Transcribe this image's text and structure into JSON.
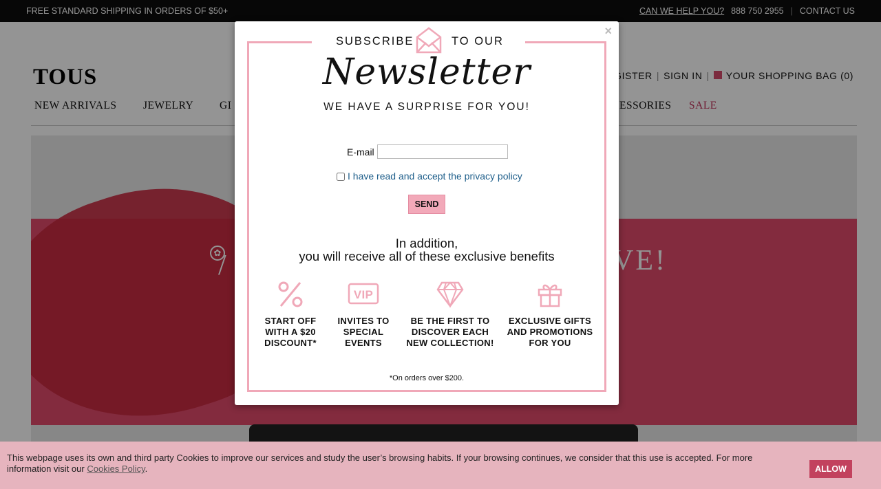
{
  "topbar": {
    "shipping": "FREE STANDARD SHIPPING IN ORDERS OF $50+",
    "help": "CAN WE HELP YOU?",
    "phone": "888 750 2955",
    "separator": "|",
    "contact": "CONTACT US"
  },
  "header": {
    "logo": "TOUS",
    "register": "REGISTER",
    "signin": "SIGN IN",
    "separator": "|",
    "bag": "YOUR SHOPPING BAG (0)"
  },
  "nav": {
    "items": [
      "NEW ARRIVALS",
      "JEWELRY",
      "GI",
      "ESSORIES",
      "SALE"
    ]
  },
  "hero": {
    "partial_left": "/",
    "partial_right": "VE!"
  },
  "modal": {
    "close": "×",
    "subscribe_left": "SUBSCRIBE",
    "subscribe_right": "TO OUR",
    "newsletter": "Newsletter",
    "surprise": "WE HAVE A SURPRISE FOR YOU!",
    "email_label": "E-mail",
    "email_value": "",
    "privacy": "I have read and accept the privacy policy",
    "send": "SEND",
    "addition_line1": "In addition,",
    "addition_line2": "you will receive all of these exclusive benefits",
    "benefits": [
      {
        "icon": "percent-icon",
        "lines": [
          "START OFF",
          "WITH A $20",
          "DISCOUNT*"
        ]
      },
      {
        "icon": "vip-icon",
        "lines": [
          "INVITES TO",
          "SPECIAL",
          "EVENTS"
        ]
      },
      {
        "icon": "diamond-icon",
        "lines": [
          "BE THE FIRST TO",
          "DISCOVER EACH",
          "NEW COLLECTION!"
        ]
      },
      {
        "icon": "gift-icon",
        "lines": [
          "EXCLUSIVE GIFTS",
          "AND PROMOTIONS",
          "FOR YOU"
        ]
      }
    ],
    "footnote": "*On orders over $200."
  },
  "cookie": {
    "text": "This webpage uses its own and third party Cookies to improve our services and study the user’s browsing habits. If your browsing continues, we consider that this use is accepted. For more information visit our ",
    "link": "Cookies Policy",
    "end": ".",
    "allow": "ALLOW"
  },
  "colors": {
    "accent_pink": "#f0a8b8",
    "sale_red": "#c0325a",
    "allow_button": "#c2425e"
  }
}
